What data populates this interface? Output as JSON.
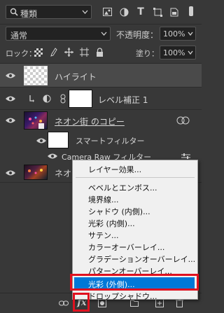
{
  "filter_row": {
    "kind_label": "種類"
  },
  "blend_row": {
    "blend_mode": "通常",
    "opacity_label": "不透明度：",
    "opacity_value": "100%"
  },
  "lock_row": {
    "lock_label": "ロック：",
    "fill_label": "塗り：",
    "fill_value": "100%"
  },
  "layers": [
    {
      "name": "ハイライト"
    },
    {
      "name": "レベル補正 1"
    },
    {
      "name": "ネオン街 のコピー"
    },
    {
      "name": "スマートフィルター"
    },
    {
      "name": "Camera Raw フィルター"
    },
    {
      "name": "ネオン"
    }
  ],
  "context_menu": {
    "items": [
      "レイヤー効果...",
      "ベベルとエンボス...",
      "境界線...",
      "シャドウ (内側)...",
      "光彩 (内側)...",
      "サテン...",
      "カラーオーバーレイ...",
      "グラデーションオーバーレイ...",
      "パターンオーバーレイ...",
      "光彩 (外側)...",
      "ドロップシャドウ..."
    ],
    "highlighted_index": 9
  },
  "colors": {
    "panel": "#383838",
    "highlight": "#0078d7",
    "annotation": "#e0111f"
  }
}
